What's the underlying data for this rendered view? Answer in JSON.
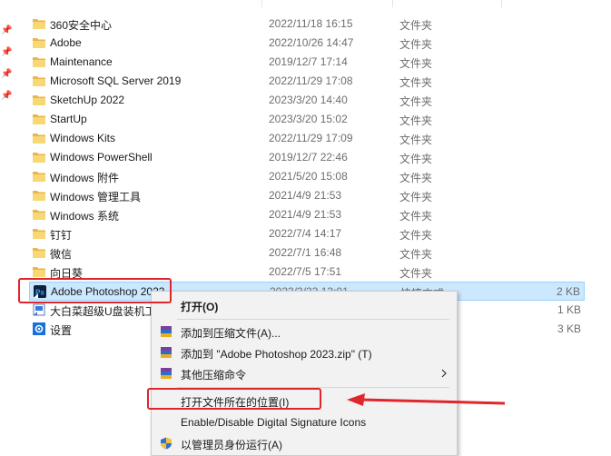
{
  "files": [
    {
      "name": "360安全中心",
      "date": "2022/11/18 16:15",
      "type": "文件夹",
      "size": "",
      "icon": "folder-icon"
    },
    {
      "name": "Adobe",
      "date": "2022/10/26 14:47",
      "type": "文件夹",
      "size": "",
      "icon": "folder-icon"
    },
    {
      "name": "Maintenance",
      "date": "2019/12/7 17:14",
      "type": "文件夹",
      "size": "",
      "icon": "folder-icon"
    },
    {
      "name": "Microsoft SQL Server 2019",
      "date": "2022/11/29 17:08",
      "type": "文件夹",
      "size": "",
      "icon": "folder-icon"
    },
    {
      "name": "SketchUp 2022",
      "date": "2023/3/20 14:40",
      "type": "文件夹",
      "size": "",
      "icon": "folder-icon"
    },
    {
      "name": "StartUp",
      "date": "2023/3/20 15:02",
      "type": "文件夹",
      "size": "",
      "icon": "folder-icon"
    },
    {
      "name": "Windows Kits",
      "date": "2022/11/29 17:09",
      "type": "文件夹",
      "size": "",
      "icon": "folder-icon"
    },
    {
      "name": "Windows PowerShell",
      "date": "2019/12/7 22:46",
      "type": "文件夹",
      "size": "",
      "icon": "folder-icon"
    },
    {
      "name": "Windows 附件",
      "date": "2021/5/20 15:08",
      "type": "文件夹",
      "size": "",
      "icon": "folder-icon"
    },
    {
      "name": "Windows 管理工具",
      "date": "2021/4/9 21:53",
      "type": "文件夹",
      "size": "",
      "icon": "folder-icon"
    },
    {
      "name": "Windows 系统",
      "date": "2021/4/9 21:53",
      "type": "文件夹",
      "size": "",
      "icon": "folder-icon"
    },
    {
      "name": "钉钉",
      "date": "2022/7/4 14:17",
      "type": "文件夹",
      "size": "",
      "icon": "folder-icon"
    },
    {
      "name": "微信",
      "date": "2022/7/1 16:48",
      "type": "文件夹",
      "size": "",
      "icon": "folder-icon"
    },
    {
      "name": "向日葵",
      "date": "2022/7/5 17:51",
      "type": "文件夹",
      "size": "",
      "icon": "folder-icon"
    },
    {
      "name": "Adobe Photoshop 2023",
      "date": "2023/3/23 13:01",
      "type": "快捷方式",
      "size": "2 KB",
      "icon": "photoshop-icon",
      "selected": true
    },
    {
      "name": "大白菜超级U盘装机工具",
      "date": "",
      "type": "",
      "size": "1 KB",
      "icon": "shortcut-app-icon"
    },
    {
      "name": "设置",
      "date": "",
      "type": "",
      "size": "3 KB",
      "icon": "settings-shortcut-icon"
    }
  ],
  "context_menu": {
    "open": "打开(O)",
    "add_archive": "添加到压缩文件(A)...",
    "add_zip": "添加到 \"Adobe Photoshop 2023.zip\" (T)",
    "other_compress": "其他压缩命令",
    "open_location": "打开文件所在的位置(I)",
    "digital_signature": "Enable/Disable Digital Signature Icons",
    "run_as_admin": "以管理员身份运行(A)"
  },
  "colors": {
    "selection_bg": "#cce8ff",
    "annotation_red": "#e0262b",
    "folder_yellow": "#f8d775"
  }
}
